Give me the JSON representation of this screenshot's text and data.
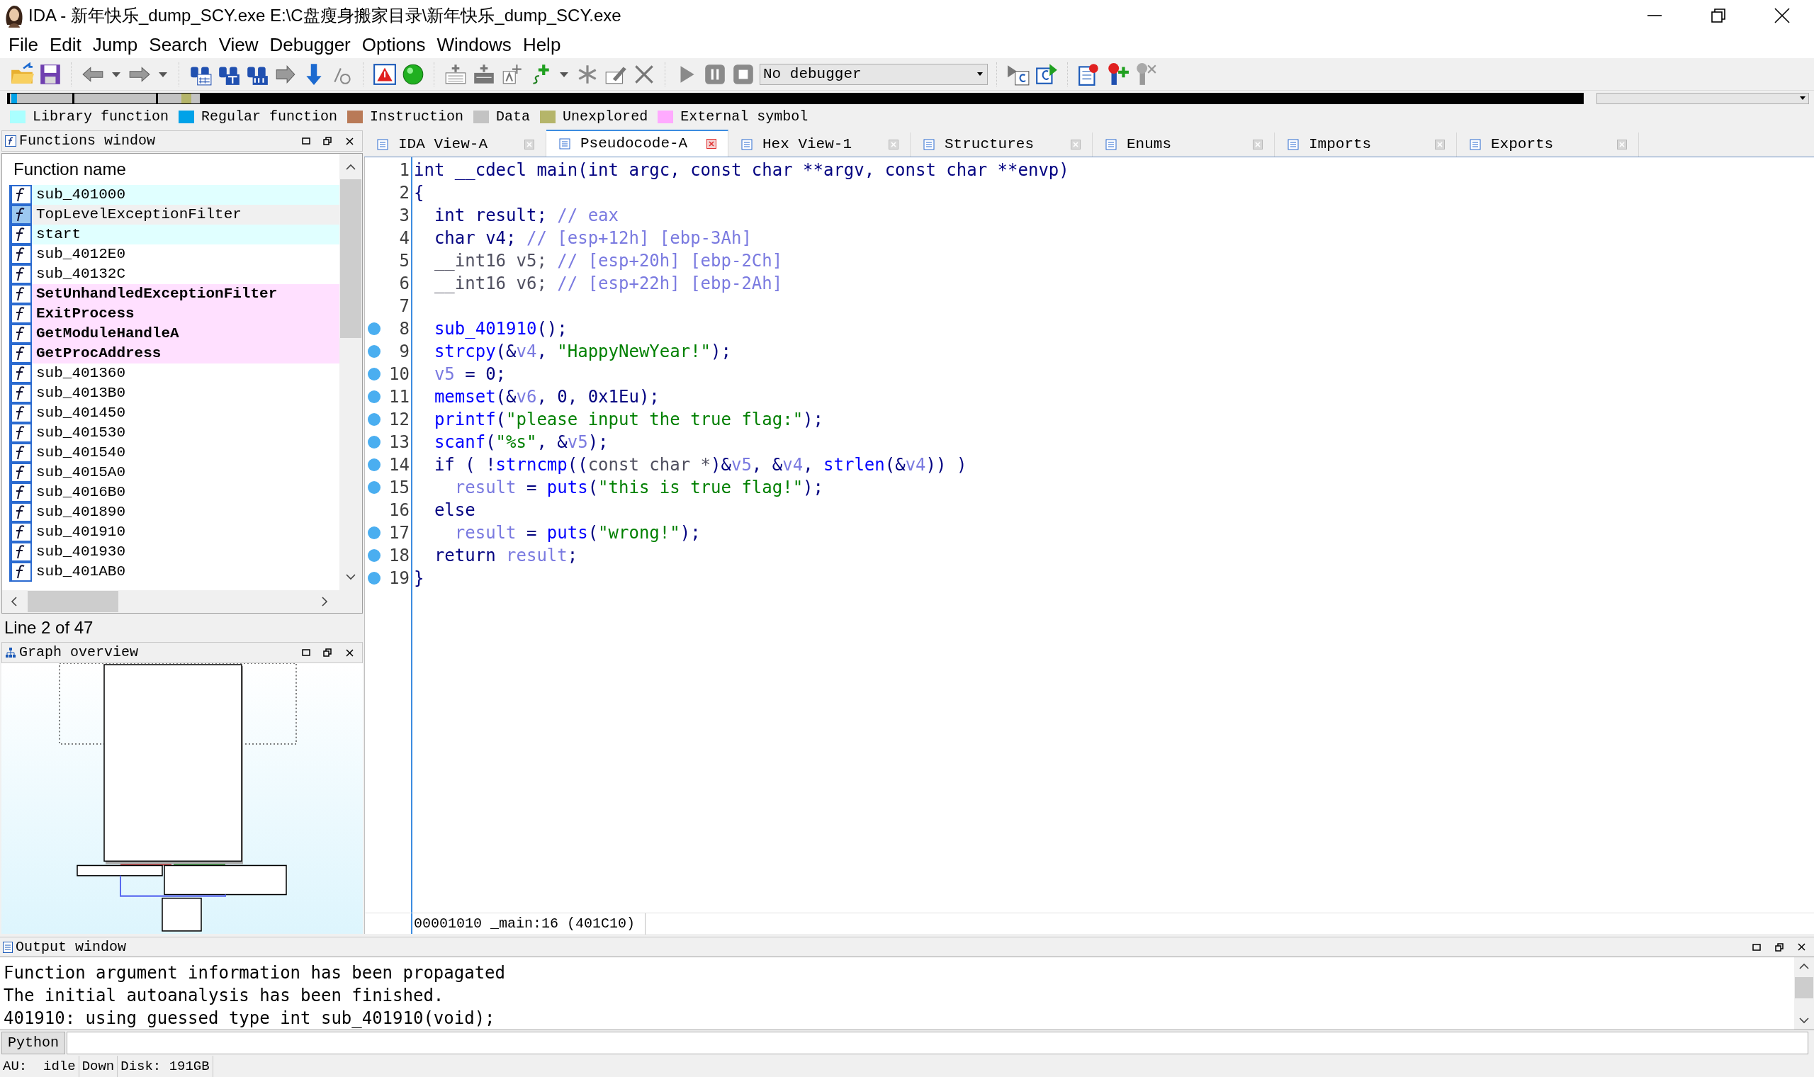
{
  "window": {
    "title": "IDA - 新年快乐_dump_SCY.exe E:\\C盘瘦身搬家目录\\新年快乐_dump_SCY.exe"
  },
  "menu": [
    "File",
    "Edit",
    "Jump",
    "Search",
    "View",
    "Debugger",
    "Options",
    "Windows",
    "Help"
  ],
  "debugger_select": {
    "value": "No debugger"
  },
  "legend": [
    {
      "label": "Library function",
      "color": "#aaffff"
    },
    {
      "label": "Regular function",
      "color": "#00a2e8"
    },
    {
      "label": "Instruction",
      "color": "#b97a57"
    },
    {
      "label": "Data",
      "color": "#c3c3c3"
    },
    {
      "label": "Unexplored",
      "color": "#b5b56a"
    },
    {
      "label": "External symbol",
      "color": "#ffaaff"
    }
  ],
  "functions_window": {
    "title": "Functions window",
    "column": "Function name",
    "items": [
      {
        "name": "sub_401000",
        "kind": "library",
        "selected": false
      },
      {
        "name": "TopLevelExceptionFilter",
        "kind": "library",
        "selected": true
      },
      {
        "name": "start",
        "kind": "library",
        "selected": false
      },
      {
        "name": "sub_4012E0",
        "kind": "regular",
        "selected": false
      },
      {
        "name": "sub_40132C",
        "kind": "regular",
        "selected": false
      },
      {
        "name": "SetUnhandledExceptionFilter",
        "kind": "external",
        "selected": false
      },
      {
        "name": "ExitProcess",
        "kind": "external",
        "selected": false
      },
      {
        "name": "GetModuleHandleA",
        "kind": "external",
        "selected": false
      },
      {
        "name": "GetProcAddress",
        "kind": "external",
        "selected": false
      },
      {
        "name": "sub_401360",
        "kind": "regular",
        "selected": false
      },
      {
        "name": "sub_4013B0",
        "kind": "regular",
        "selected": false
      },
      {
        "name": "sub_401450",
        "kind": "regular",
        "selected": false
      },
      {
        "name": "sub_401530",
        "kind": "regular",
        "selected": false
      },
      {
        "name": "sub_401540",
        "kind": "regular",
        "selected": false
      },
      {
        "name": "sub_4015A0",
        "kind": "regular",
        "selected": false
      },
      {
        "name": "sub_4016B0",
        "kind": "regular",
        "selected": false
      },
      {
        "name": "sub_401890",
        "kind": "regular",
        "selected": false
      },
      {
        "name": "sub_401910",
        "kind": "regular",
        "selected": false
      },
      {
        "name": "sub_401930",
        "kind": "regular",
        "selected": false
      },
      {
        "name": "sub_401AB0",
        "kind": "regular",
        "selected": false
      }
    ],
    "status": "Line 2 of 47"
  },
  "graph_overview": {
    "title": "Graph overview"
  },
  "tabs": [
    {
      "label": "IDA View-A",
      "selected": false
    },
    {
      "label": "Pseudocode-A",
      "selected": true
    },
    {
      "label": "Hex View-1",
      "selected": false
    },
    {
      "label": "Structures",
      "selected": false
    },
    {
      "label": "Enums",
      "selected": false
    },
    {
      "label": "Imports",
      "selected": false
    },
    {
      "label": "Exports",
      "selected": false
    }
  ],
  "code": {
    "lines": [
      {
        "number": "1",
        "breakpoint": false,
        "tokens": [
          {
            "kind": "plain",
            "t": "int __cdecl main(int argc, const char **argv, const char **envp)"
          }
        ]
      },
      {
        "number": "2",
        "breakpoint": false,
        "tokens": [
          {
            "kind": "plain",
            "t": "{"
          }
        ]
      },
      {
        "number": "3",
        "breakpoint": false,
        "tokens": [
          {
            "kind": "plain",
            "t": "  int result; "
          },
          {
            "kind": "comment",
            "t": "// eax"
          }
        ]
      },
      {
        "number": "4",
        "breakpoint": false,
        "tokens": [
          {
            "kind": "plain",
            "t": "  char v4; "
          },
          {
            "kind": "comment",
            "t": "// [esp+12h] [ebp-3Ah]"
          }
        ]
      },
      {
        "number": "5",
        "breakpoint": false,
        "tokens": [
          {
            "kind": "cast",
            "t": "  __int16 v5; "
          },
          {
            "kind": "comment",
            "t": "// [esp+20h] [ebp-2Ch]"
          }
        ]
      },
      {
        "number": "6",
        "breakpoint": false,
        "tokens": [
          {
            "kind": "cast",
            "t": "  __int16 v6; "
          },
          {
            "kind": "comment",
            "t": "// [esp+22h] [ebp-2Ah]"
          }
        ]
      },
      {
        "number": "7",
        "breakpoint": false
      },
      {
        "number": "8",
        "breakpoint": true,
        "tokens": [
          {
            "kind": "func",
            "t": "  sub_401910"
          },
          {
            "kind": "plain",
            "t": "();"
          }
        ]
      },
      {
        "number": "9",
        "breakpoint": true,
        "tokens": [
          {
            "kind": "func",
            "t": "  strcpy"
          },
          {
            "kind": "plain",
            "t": "(&"
          },
          {
            "kind": "var",
            "t": "v4"
          },
          {
            "kind": "plain",
            "t": ", "
          },
          {
            "kind": "string",
            "t": "\"HappyNewYear!\""
          },
          {
            "kind": "plain",
            "t": ");"
          }
        ]
      },
      {
        "number": "10",
        "breakpoint": true,
        "tokens": [
          {
            "kind": "var",
            "t": "  v5"
          },
          {
            "kind": "plain",
            "t": " = 0;"
          }
        ]
      },
      {
        "number": "11",
        "breakpoint": true,
        "tokens": [
          {
            "kind": "func",
            "t": "  memset"
          },
          {
            "kind": "plain",
            "t": "(&"
          },
          {
            "kind": "var",
            "t": "v6"
          },
          {
            "kind": "plain",
            "t": ", 0, 0x1Eu);"
          }
        ]
      },
      {
        "number": "12",
        "breakpoint": true,
        "tokens": [
          {
            "kind": "func",
            "t": "  printf"
          },
          {
            "kind": "plain",
            "t": "("
          },
          {
            "kind": "string",
            "t": "\"please input the true flag:\""
          },
          {
            "kind": "plain",
            "t": ");"
          }
        ]
      },
      {
        "number": "13",
        "breakpoint": true,
        "tokens": [
          {
            "kind": "func",
            "t": "  scanf"
          },
          {
            "kind": "plain",
            "t": "("
          },
          {
            "kind": "string",
            "t": "\"%s\""
          },
          {
            "kind": "plain",
            "t": ", &"
          },
          {
            "kind": "var",
            "t": "v5"
          },
          {
            "kind": "plain",
            "t": ");"
          }
        ]
      },
      {
        "number": "14",
        "breakpoint": true,
        "tokens": [
          {
            "kind": "plain",
            "t": "  if ( !"
          },
          {
            "kind": "func",
            "t": "strncmp"
          },
          {
            "kind": "plain",
            "t": "(("
          },
          {
            "kind": "cast",
            "t": "const char *"
          },
          {
            "kind": "plain",
            "t": ")&"
          },
          {
            "kind": "var",
            "t": "v5"
          },
          {
            "kind": "plain",
            "t": ", &"
          },
          {
            "kind": "var",
            "t": "v4"
          },
          {
            "kind": "plain",
            "t": ", "
          },
          {
            "kind": "func",
            "t": "strlen"
          },
          {
            "kind": "plain",
            "t": "(&"
          },
          {
            "kind": "var",
            "t": "v4"
          },
          {
            "kind": "plain",
            "t": ")) )"
          }
        ]
      },
      {
        "number": "15",
        "breakpoint": true,
        "tokens": [
          {
            "kind": "var",
            "t": "    result"
          },
          {
            "kind": "plain",
            "t": " = "
          },
          {
            "kind": "func",
            "t": "puts"
          },
          {
            "kind": "plain",
            "t": "("
          },
          {
            "kind": "string",
            "t": "\"this is true flag!\""
          },
          {
            "kind": "plain",
            "t": ");"
          }
        ]
      },
      {
        "number": "16",
        "breakpoint": false,
        "tokens": [
          {
            "kind": "plain",
            "t": "  else"
          }
        ]
      },
      {
        "number": "17",
        "breakpoint": true,
        "tokens": [
          {
            "kind": "var",
            "t": "    result"
          },
          {
            "kind": "plain",
            "t": " = "
          },
          {
            "kind": "func",
            "t": "puts"
          },
          {
            "kind": "plain",
            "t": "("
          },
          {
            "kind": "string",
            "t": "\"wrong!\""
          },
          {
            "kind": "plain",
            "t": ");"
          }
        ]
      },
      {
        "number": "18",
        "breakpoint": true,
        "tokens": [
          {
            "kind": "plain",
            "t": "  return "
          },
          {
            "kind": "var",
            "t": "result"
          },
          {
            "kind": "plain",
            "t": ";"
          }
        ]
      },
      {
        "number": "19",
        "breakpoint": true,
        "tokens": [
          {
            "kind": "plain",
            "t": "}"
          }
        ]
      }
    ],
    "location": "00001010 _main:16 (401C10)"
  },
  "output_window": {
    "title": "Output window",
    "lines": [
      "Function argument information has been propagated",
      "The initial autoanalysis has been finished.",
      "401910: using guessed type int sub_401910(void);"
    ],
    "command_button": "Python"
  },
  "status_bar": [
    "AU:  idle",
    "Down",
    "Disk: 191GB"
  ]
}
